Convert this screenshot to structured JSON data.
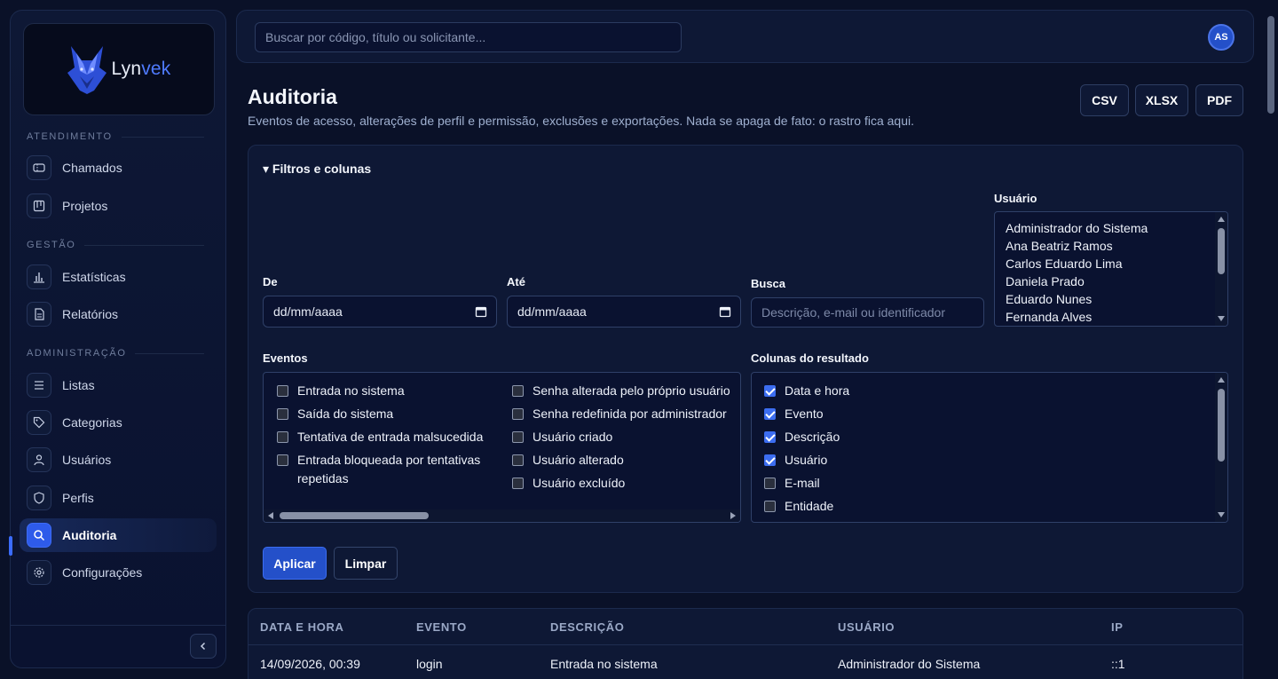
{
  "brand": {
    "name_main": "Lyn",
    "name_accent": "vek"
  },
  "sidebar": {
    "sections": [
      {
        "title": "ATENDIMENTO"
      },
      {
        "title": "GESTÃO"
      },
      {
        "title": "ADMINISTRAÇÃO"
      }
    ],
    "items": [
      {
        "label": "Chamados",
        "icon": "ticket-icon"
      },
      {
        "label": "Projetos",
        "icon": "kanban-icon"
      },
      {
        "label": "Estatísticas",
        "icon": "bar-chart-icon"
      },
      {
        "label": "Relatórios",
        "icon": "document-icon"
      },
      {
        "label": "Listas",
        "icon": "list-icon"
      },
      {
        "label": "Categorias",
        "icon": "tag-icon"
      },
      {
        "label": "Usuários",
        "icon": "user-icon"
      },
      {
        "label": "Perfis",
        "icon": "shield-icon"
      },
      {
        "label": "Auditoria",
        "icon": "search-icon",
        "active": true
      },
      {
        "label": "Configurações",
        "icon": "gear-icon"
      }
    ]
  },
  "topbar": {
    "search_placeholder": "Buscar por código, título ou solicitante...",
    "avatar_initials": "AS"
  },
  "header": {
    "title": "Auditoria",
    "subtitle": "Eventos de acesso, alterações de perfil e permissão, exclusões e exportações. Nada se apaga de fato: o rastro fica aqui.",
    "exports": [
      "CSV",
      "XLSX",
      "PDF"
    ]
  },
  "filters": {
    "summary": "▾ Filtros e colunas",
    "from_label": "De",
    "from_value": "dd/mm/aaaa",
    "to_label": "Até",
    "to_value": "dd/mm/aaaa",
    "search_label": "Busca",
    "search_placeholder": "Descrição, e-mail ou identificador",
    "user_label": "Usuário",
    "users": [
      "Administrador do Sistema",
      "Ana Beatriz Ramos",
      "Carlos Eduardo Lima",
      "Daniela Prado",
      "Eduardo Nunes",
      "Fernanda Alves"
    ],
    "events_label": "Eventos",
    "events_col1": [
      {
        "label": "Entrada no sistema",
        "checked": false
      },
      {
        "label": "Saída do sistema",
        "checked": false
      },
      {
        "label": "Tentativa de entrada malsucedida",
        "checked": false
      },
      {
        "label": "Entrada bloqueada por tentativas repetidas",
        "checked": false
      }
    ],
    "events_col2": [
      {
        "label": "Senha alterada pelo próprio usuário",
        "checked": false
      },
      {
        "label": "Senha redefinida por administrador",
        "checked": false
      },
      {
        "label": "Usuário criado",
        "checked": false
      },
      {
        "label": "Usuário alterado",
        "checked": false
      },
      {
        "label": "Usuário excluído",
        "checked": false
      }
    ],
    "columns_label": "Colunas do resultado",
    "columns": [
      {
        "label": "Data e hora",
        "checked": true
      },
      {
        "label": "Evento",
        "checked": true
      },
      {
        "label": "Descrição",
        "checked": true
      },
      {
        "label": "Usuário",
        "checked": true
      },
      {
        "label": "E-mail",
        "checked": false
      },
      {
        "label": "Entidade",
        "checked": false
      }
    ],
    "apply_label": "Aplicar",
    "clear_label": "Limpar"
  },
  "table": {
    "headers": [
      "DATA E HORA",
      "EVENTO",
      "DESCRIÇÃO",
      "USUÁRIO",
      "IP"
    ],
    "rows": [
      [
        "14/09/2026, 00:39",
        "login",
        "Entrada no sistema",
        "Administrador do Sistema",
        "::1"
      ]
    ]
  },
  "colors": {
    "accent": "#2450c9",
    "background": "#0a1128",
    "panel": "#0e1835"
  }
}
